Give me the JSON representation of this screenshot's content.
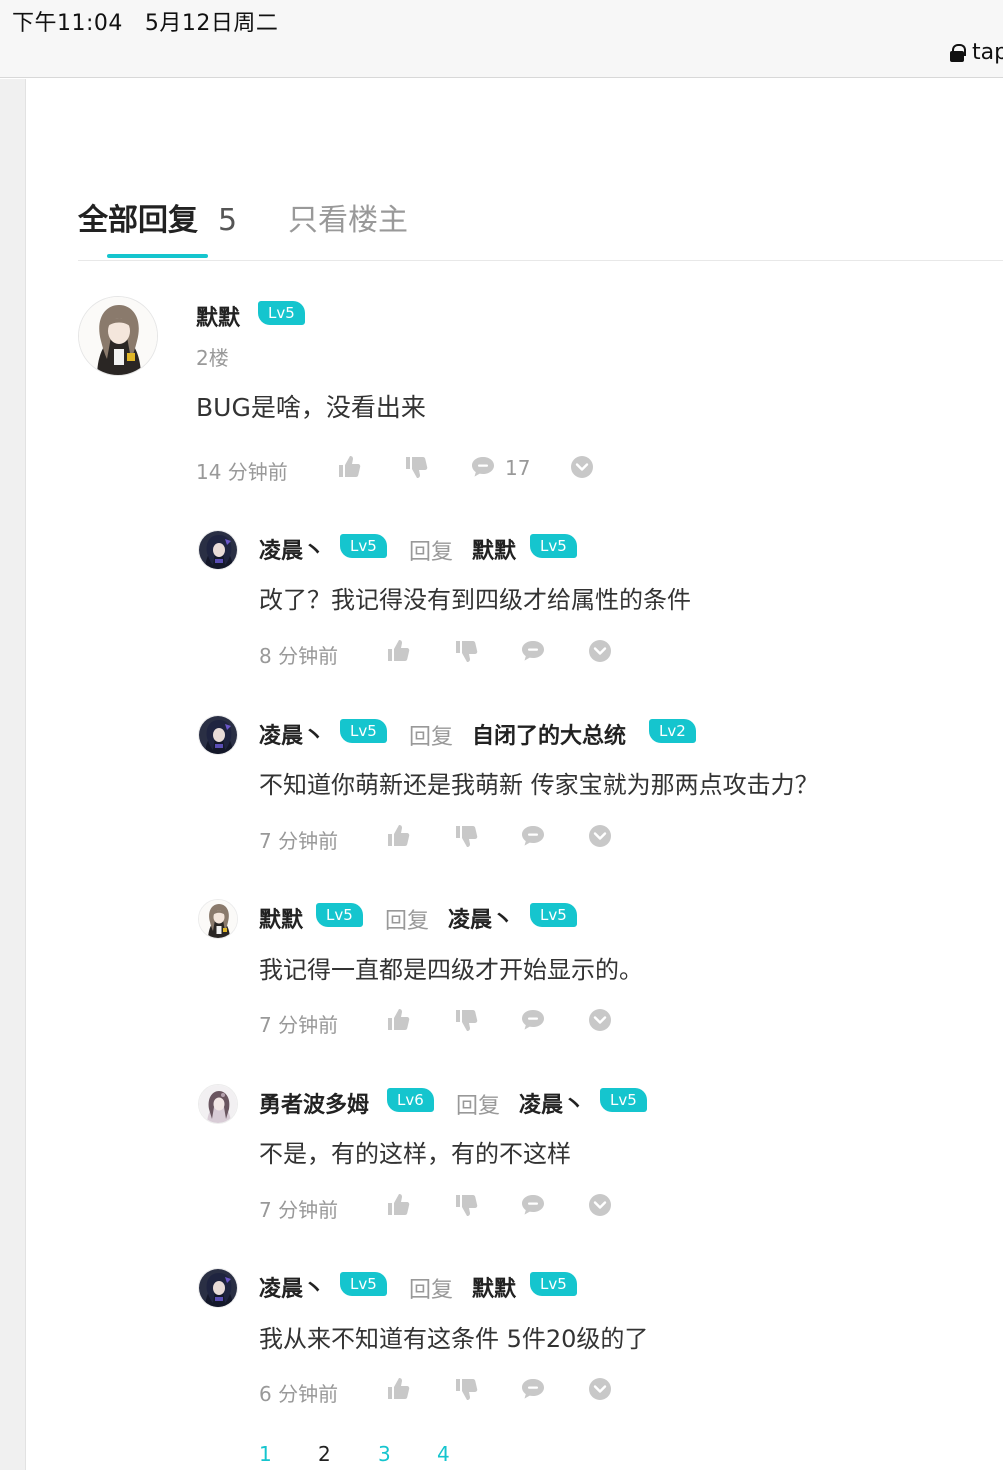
{
  "status": {
    "time": "下午11:04",
    "date": "5月12日周二",
    "url": "tap"
  },
  "tabs": {
    "all_label": "全部回复",
    "all_count": "5",
    "op_only_label": "只看楼主"
  },
  "post": {
    "author": "默默",
    "level": "Lv5",
    "floor": "2楼",
    "content": "BUG是啥，没看出来",
    "time": "14 分钟前",
    "reply_count": "17"
  },
  "reply_word": "回复",
  "replies": [
    {
      "author": "凌晨丶",
      "level": "Lv5",
      "to": "默默",
      "to_level": "Lv5",
      "content": "改了？我记得没有到四级才给属性的条件",
      "time": "8 分钟前"
    },
    {
      "author": "凌晨丶",
      "level": "Lv5",
      "to": "自闭了的大总统",
      "to_level": "Lv2",
      "content": "不知道你萌新还是我萌新 传家宝就为那两点攻击力？",
      "time": "7 分钟前"
    },
    {
      "author": "默默",
      "level": "Lv5",
      "to": "凌晨丶",
      "to_level": "Lv5",
      "content": "我记得一直都是四级才开始显示的。",
      "time": "7 分钟前"
    },
    {
      "author": "勇者波多姆",
      "level": "Lv6",
      "to": "凌晨丶",
      "to_level": "Lv5",
      "content": "不是，有的这样，有的不这样",
      "time": "7 分钟前"
    },
    {
      "author": "凌晨丶",
      "level": "Lv5",
      "to": "默默",
      "to_level": "Lv5",
      "content": "我从来不知道有这条件 5件20级的了",
      "time": "6 分钟前"
    }
  ],
  "pagination": [
    "1",
    "2",
    "3",
    "4"
  ],
  "colors": {
    "accent": "#15c5ce",
    "muted": "#999999",
    "text": "#333333"
  }
}
